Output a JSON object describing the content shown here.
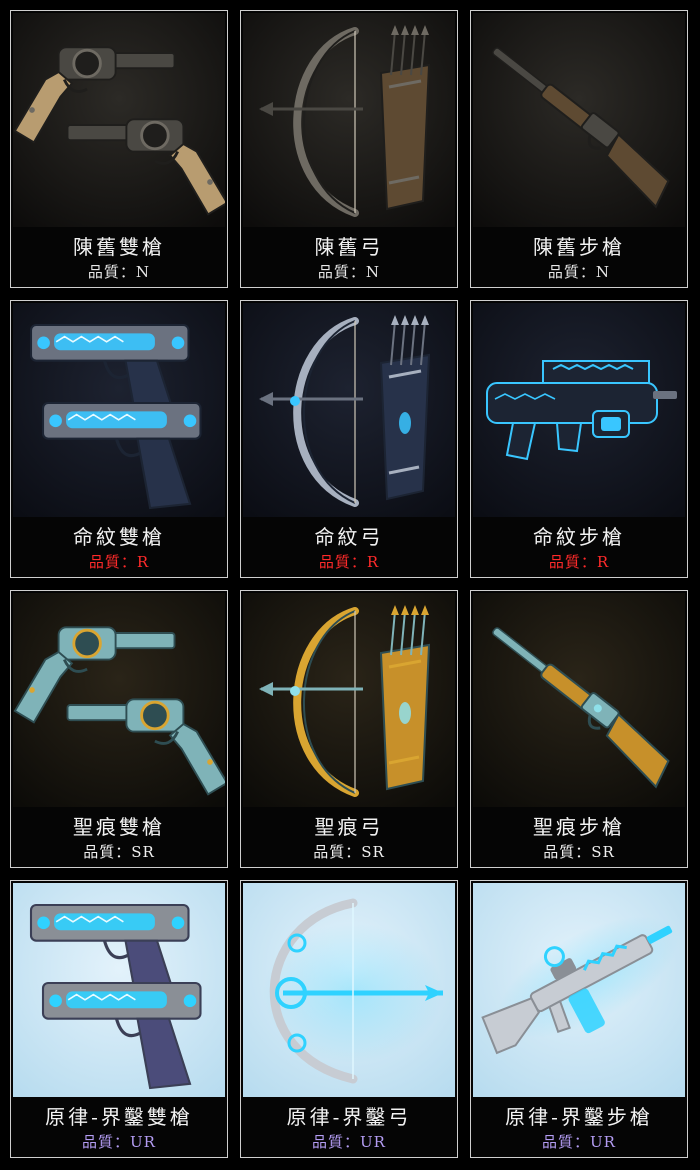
{
  "colors": {
    "N": "#e8e8e8",
    "R": "#ff2a2a",
    "SR": "#f0f0f0",
    "UR": "#b39cf2"
  },
  "rows": [
    {
      "tier": "N",
      "art_style": "rusty-iron",
      "items": [
        {
          "name": "陳舊雙槍",
          "quality": "品質：N",
          "icon": "dual-revolver-icon"
        },
        {
          "name": "陳舊弓",
          "quality": "品質：N",
          "icon": "bow-quiver-icon"
        },
        {
          "name": "陳舊步槍",
          "quality": "品質：N",
          "icon": "rifle-icon"
        }
      ]
    },
    {
      "tier": "R",
      "art_style": "rune-steel",
      "items": [
        {
          "name": "命紋雙槍",
          "quality": "品質：R",
          "icon": "dual-pistol-icon"
        },
        {
          "name": "命紋弓",
          "quality": "品質：R",
          "icon": "bow-quiver-icon"
        },
        {
          "name": "命紋步槍",
          "quality": "品質：R",
          "icon": "rifle-icon"
        }
      ]
    },
    {
      "tier": "SR",
      "art_style": "gold-turquoise",
      "items": [
        {
          "name": "聖痕雙槍",
          "quality": "品質：SR",
          "icon": "dual-revolver-icon"
        },
        {
          "name": "聖痕弓",
          "quality": "品質：SR",
          "icon": "bow-quiver-icon"
        },
        {
          "name": "聖痕步槍",
          "quality": "品質：SR",
          "icon": "rifle-icon"
        }
      ]
    },
    {
      "tier": "UR",
      "art_style": "frost-energy",
      "items": [
        {
          "name": "原律-界鑿雙槍",
          "quality": "品質：UR",
          "icon": "dual-pistol-icon"
        },
        {
          "name": "原律-界鑿弓",
          "quality": "品質：UR",
          "icon": "energy-bow-icon"
        },
        {
          "name": "原律-界鑿步槍",
          "quality": "品質：UR",
          "icon": "assault-rifle-icon"
        }
      ]
    }
  ]
}
